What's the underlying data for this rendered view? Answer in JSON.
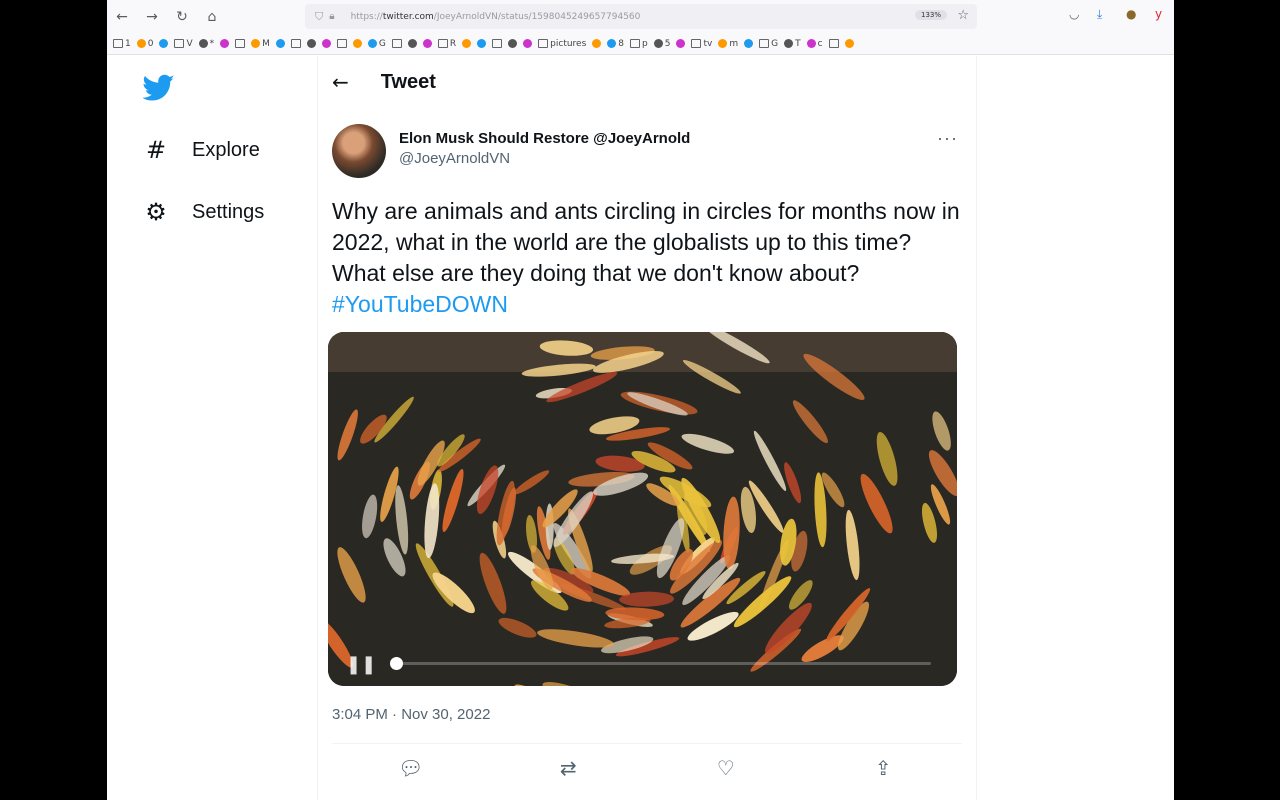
{
  "browser": {
    "url_host": "twitter.com",
    "url_path": "/JoeyArnoldVN/status/1598045249657794560",
    "url_prefix": "https://",
    "zoom": "133%",
    "bookmarks": [
      "1",
      "0",
      "",
      "V",
      "*",
      "",
      "",
      "M",
      "",
      "",
      "",
      "",
      "",
      "",
      "G",
      "",
      "",
      "",
      "R",
      "",
      "",
      "",
      "",
      "",
      "pictures",
      "",
      "8",
      "p",
      "5",
      "",
      "tv",
      "m",
      "",
      "G",
      "T",
      "c",
      "",
      ""
    ]
  },
  "sidebar": {
    "items": [
      {
        "label": "Explore",
        "icon": "hashtag-icon"
      },
      {
        "label": "Settings",
        "icon": "gear-icon"
      }
    ]
  },
  "header": {
    "title": "Tweet"
  },
  "tweet": {
    "display_name": "Elon Musk Should Restore @JoeyArnold",
    "handle": "@JoeyArnoldVN",
    "text": "Why are animals and ants circling in circles for months now in 2022, what in the world are the globalists up to this time? What else are they doing that we don't know about? ",
    "hashtag": "#YouTubeDOWN",
    "timestamp": "3:04 PM · Nov 30, 2022",
    "video_progress": 0.0
  },
  "colors": {
    "brand": "#1d9bf0",
    "text": "#0f1419",
    "muted": "#536471"
  }
}
